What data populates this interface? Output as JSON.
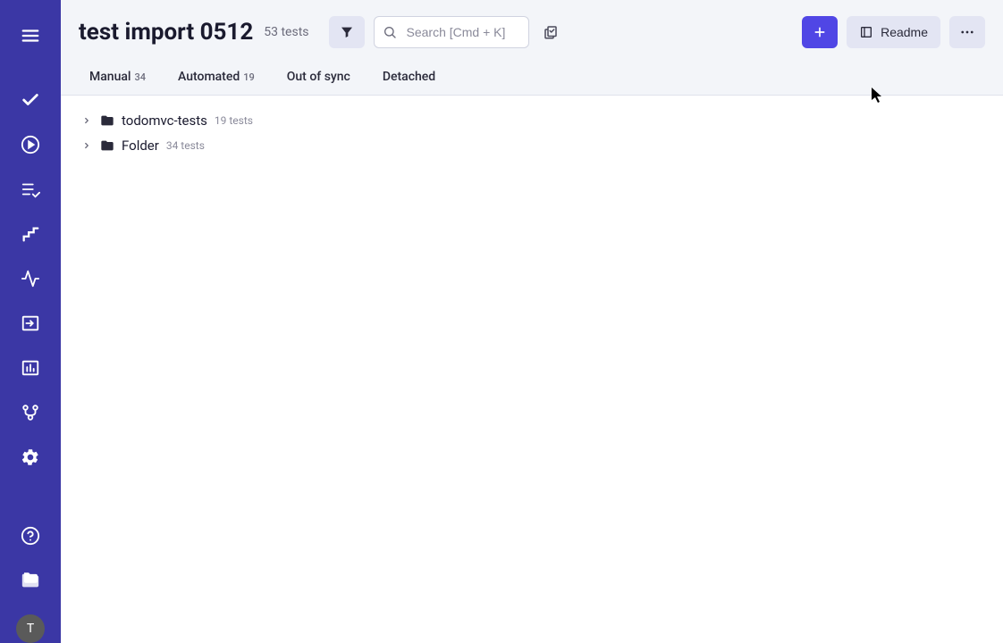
{
  "header": {
    "title": "test import 0512",
    "test_count": "53 tests",
    "search_placeholder": "Search [Cmd + K]",
    "readme_label": "Readme"
  },
  "tabs": [
    {
      "label": "Manual",
      "count": "34"
    },
    {
      "label": "Automated",
      "count": "19"
    },
    {
      "label": "Out of sync",
      "count": ""
    },
    {
      "label": "Detached",
      "count": ""
    }
  ],
  "folders": [
    {
      "name": "todomvc-tests",
      "count": "19 tests"
    },
    {
      "name": "Folder",
      "count": "34 tests"
    }
  ],
  "avatar_initial": "T"
}
